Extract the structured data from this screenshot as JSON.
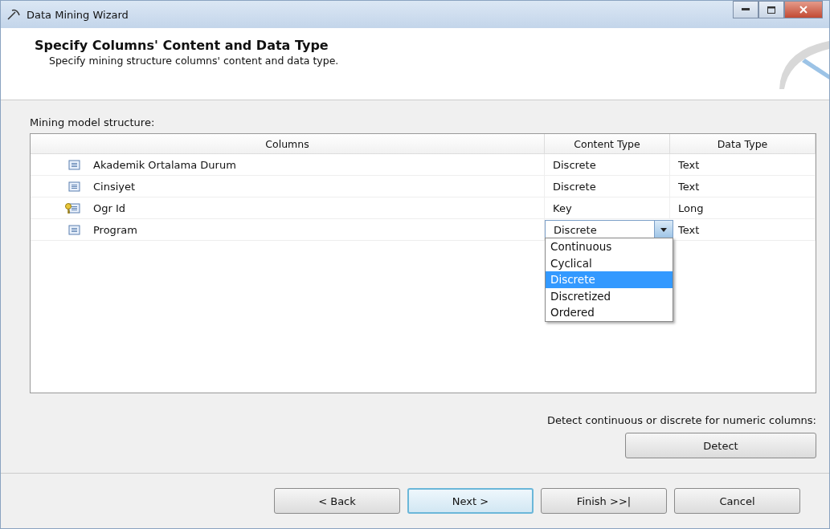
{
  "window": {
    "title": "Data Mining Wizard"
  },
  "header": {
    "title": "Specify Columns' Content and Data Type",
    "subtitle": "Specify mining structure columns' content and data type."
  },
  "table": {
    "label": "Mining model structure:",
    "columns": [
      "Columns",
      "Content Type",
      "Data Type"
    ],
    "rows": [
      {
        "kind": "column",
        "name": "Akademik Ortalama Durum",
        "content_type": "Discrete",
        "data_type": "Text",
        "editing": false
      },
      {
        "kind": "column",
        "name": "Cinsiyet",
        "content_type": "Discrete",
        "data_type": "Text",
        "editing": false
      },
      {
        "kind": "key",
        "name": "Ogr Id",
        "content_type": "Key",
        "data_type": "Long",
        "editing": false
      },
      {
        "kind": "column",
        "name": "Program",
        "content_type": "Discrete",
        "data_type": "Text",
        "editing": true
      }
    ]
  },
  "dropdown": {
    "options": [
      {
        "label": "Continuous",
        "selected": false
      },
      {
        "label": "Cyclical",
        "selected": false
      },
      {
        "label": "Discrete",
        "selected": true
      },
      {
        "label": "Discretized",
        "selected": false
      },
      {
        "label": "Ordered",
        "selected": false
      }
    ]
  },
  "detect": {
    "label": "Detect continuous or discrete for numeric columns:",
    "button": "Detect"
  },
  "buttons": [
    {
      "label": "< Back",
      "focused": false
    },
    {
      "label": "Next >",
      "focused": true
    },
    {
      "label": "Finish >>|",
      "focused": false
    },
    {
      "label": "Cancel",
      "focused": false
    }
  ]
}
